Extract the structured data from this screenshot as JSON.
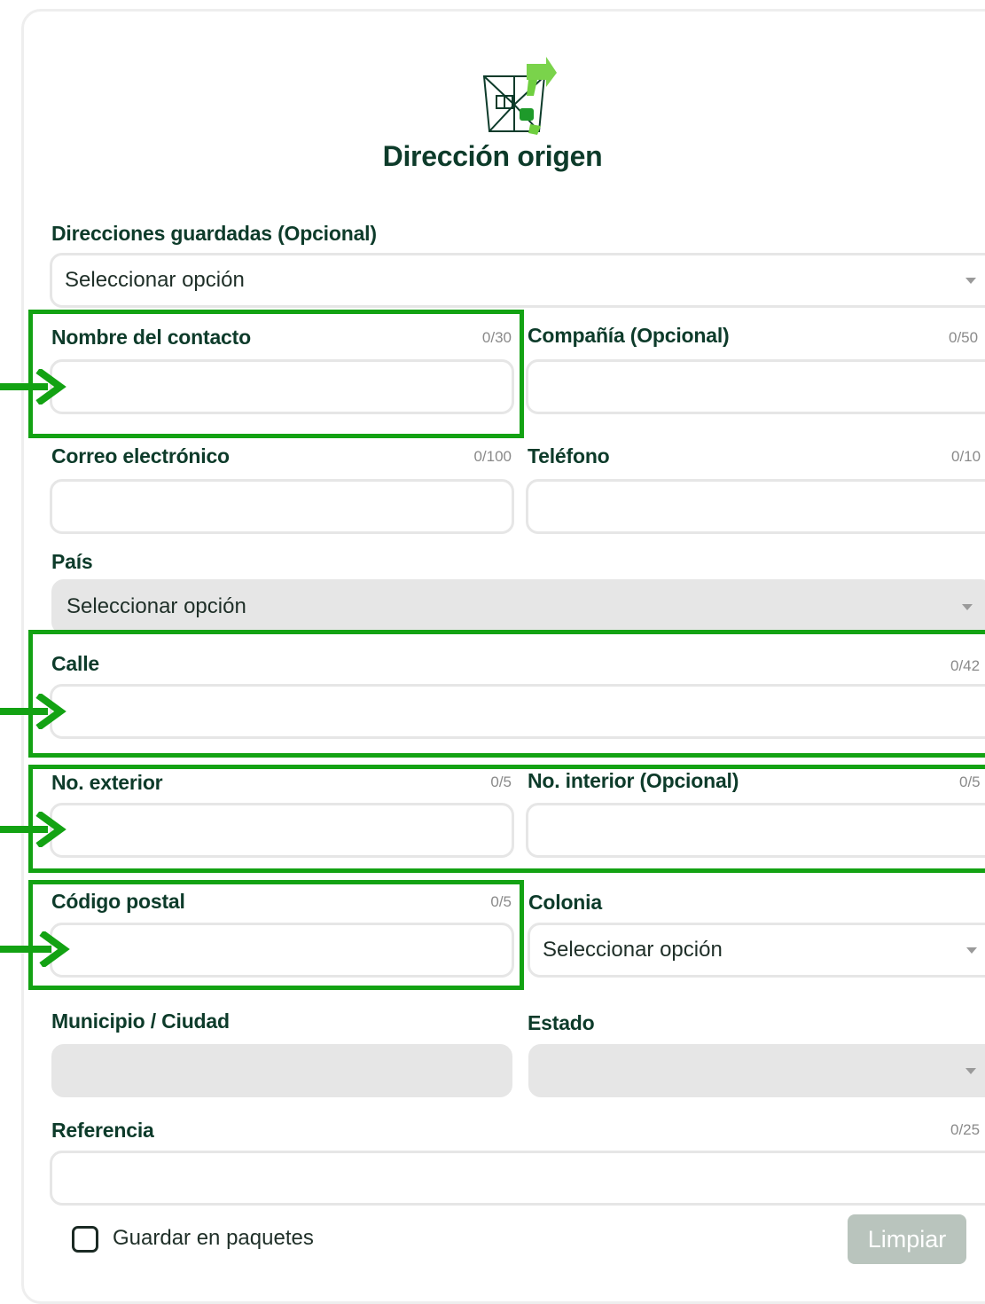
{
  "header": {
    "title": "Dirección origen",
    "logo_icon": "package-arrow-icon"
  },
  "fields": {
    "saved": {
      "label": "Direcciones guardadas (Opcional)",
      "value": "Seleccionar opción"
    },
    "contact": {
      "label": "Nombre del contacto",
      "counter": "0/30"
    },
    "company": {
      "label": "Compañía (Opcional)",
      "counter": "0/50"
    },
    "email": {
      "label": "Correo electrónico",
      "counter": "0/100"
    },
    "phone": {
      "label": "Teléfono",
      "counter": "0/10"
    },
    "country": {
      "label": "País",
      "value": "Seleccionar opción"
    },
    "street": {
      "label": "Calle",
      "counter": "0/42"
    },
    "ext": {
      "label": "No. exterior",
      "counter": "0/5"
    },
    "int": {
      "label": "No. interior (Opcional)",
      "counter": "0/5"
    },
    "zip": {
      "label": "Código postal",
      "counter": "0/5"
    },
    "colonia": {
      "label": "Colonia",
      "value": "Seleccionar opción"
    },
    "city": {
      "label": "Municipio / Ciudad"
    },
    "state": {
      "label": "Estado"
    },
    "reference": {
      "label": "Referencia",
      "counter": "0/25"
    }
  },
  "footer": {
    "save_label": "Guardar en paquetes",
    "clear_label": "Limpiar"
  },
  "colors": {
    "brand": "#0d3b2a",
    "highlight": "#13a213",
    "button_disabled": "#b9c4bd"
  }
}
